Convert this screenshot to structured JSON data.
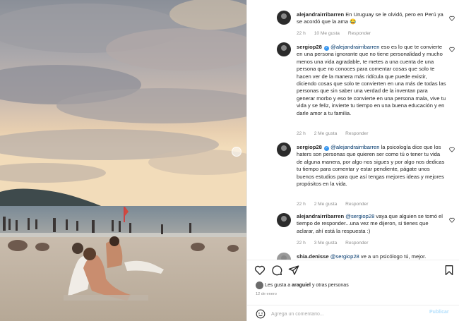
{
  "comments": [
    {
      "user": "alejandrairribarren",
      "text": "En Uruguay se le olvidó, pero en Perú ya se acordó que la ama 😂",
      "time": "22 h",
      "likes": "10 Me gusta",
      "reply": "Responder"
    },
    {
      "user": "sergiop28",
      "mention": "@alejandrairribarren",
      "text": " eso es lo que te convierte en una persona ignorante que no tiene personalidad y mucho menos una vida agradable, te metes a una cuenta de una persona que no conoces para comentar cosas que solo te hacen ver de la manera más ridícula que puede existir, diciendo cosas que solo te convierten en una más de todas las personas que sin saber una verdad de la inventan para generar morbo y eso te convierte en una persona mala, vive tu vida y se feliz, invierte tu tiempo en una buena educación y en darle amor a tu familia.",
      "time": "22 h",
      "likes": "2 Me gusta",
      "reply": "Responder"
    },
    {
      "user": "sergiop28",
      "mention": "@alejandrairribarren",
      "text": " la psicología dice que los haters son personas que quieren ser como tú o tener tu vida de alguna manera, por algo nos sigues y por algo nos dedicas tu tiempo para comentar y estar pendiente, págate unos buenos estudios para que así tengas mejores ideas y mejores propósitos en la vida.",
      "time": "22 h",
      "likes": "2 Me gusta",
      "reply": "Responder"
    },
    {
      "user": "alejandrairribarren",
      "mention": "@sergiop28",
      "text": " vaya que alguien se tomó el tiempo de responder...una vez me dijeron, si tienes que aclarar, ahí está la respuesta :)",
      "time": "22 h",
      "likes": "3 Me gusta",
      "reply": "Responder"
    },
    {
      "user": "shia.denisse",
      "mention": "@sergiop28",
      "text": " ve a un psicólogo tú, mejor."
    }
  ],
  "likes": {
    "prefix": "Les gusta a ",
    "user": "araguiel",
    "suffix": " y otras personas"
  },
  "post_date": "12 de enero",
  "add_comment": {
    "placeholder": "Agrega un comentario...",
    "publish_label": "Publicar"
  },
  "icons": {
    "like": "heart-icon",
    "comment": "speech-bubble-icon",
    "share": "paper-plane-icon",
    "save": "bookmark-icon",
    "emoji": "smiley-icon",
    "comment_like": "small-heart-icon"
  },
  "colors": {
    "text": "#262626",
    "meta": "#8e8e8e",
    "mention": "#00376b",
    "verified": "#3897f0",
    "publish": "#b2dffc"
  }
}
